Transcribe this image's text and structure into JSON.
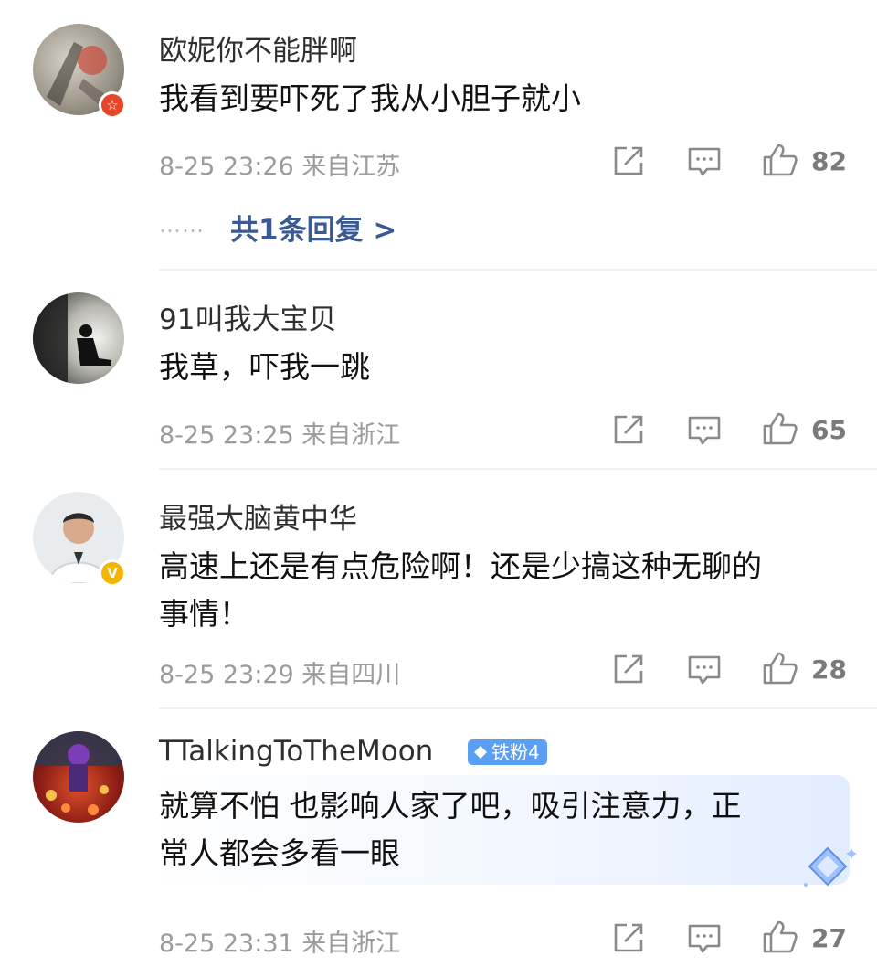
{
  "comments": [
    {
      "username": "欧妮你不能胖啊",
      "lines": [
        "我看到要吓死了我从小胆子就小"
      ],
      "meta": "8-25 23:26 来自江苏",
      "likes": "82",
      "replies": {
        "dots": "……",
        "label": "共1条回复 >"
      }
    },
    {
      "username": "91叫我大宝贝",
      "lines": [
        "我草，吓我一跳"
      ],
      "meta": "8-25 23:25 来自浙江",
      "likes": "65"
    },
    {
      "username": "最强大脑黄中华",
      "lines": [
        "高速上还是有点危险啊！还是少搞这种无聊的",
        "事情！"
      ],
      "meta": "8-25 23:29 来自四川",
      "likes": "28",
      "verified": "V"
    },
    {
      "username": "TTalkingToTheMoon",
      "fan_badge": "铁粉4",
      "lines": [
        "就算不怕 也影响人家了吧，吸引注意力，正",
        "常人都会多看一眼"
      ],
      "meta": "8-25 23:31 来自浙江",
      "likes": "27"
    }
  ],
  "icons": [
    "share-icon",
    "comment-icon",
    "like-icon"
  ],
  "colors": {
    "link": "#3b5a91",
    "meta": "#9b9b9b",
    "fan_badge": "#5b9ff5"
  }
}
